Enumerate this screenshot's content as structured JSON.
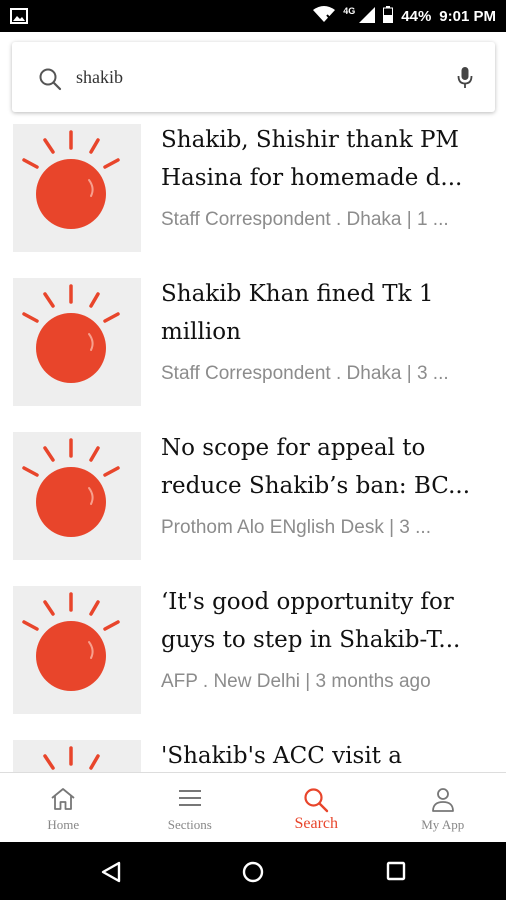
{
  "status_bar": {
    "network": "4G",
    "battery": "44%",
    "time": "9:01 PM"
  },
  "search": {
    "query": "shakib",
    "placeholder": ""
  },
  "colors": {
    "accent": "#e8452b",
    "thumb_bg": "#eeeeee",
    "meta_text": "#8c8c8c"
  },
  "articles": [
    {
      "line1": "Shakib, Shishir thank PM",
      "line2": "Hasina for homemade d...",
      "meta": "Staff Correspondent . Dhaka | 1 ..."
    },
    {
      "line1": "Shakib Khan fined Tk 1",
      "line2": "million",
      "meta": "Staff Correspondent . Dhaka | 3 ..."
    },
    {
      "line1": "No scope for appeal to",
      "line2": "reduce Shakib’s ban: BC...",
      "meta": "Prothom Alo ENglish Desk | 3  ..."
    },
    {
      "line1": "‘It's good opportunity for",
      "line2": "guys to step in Shakib-T...",
      "meta": "AFP . New Delhi | 3  months ago"
    },
    {
      "line1": "'Shakib's ACC visit a",
      "line2": "",
      "meta": ""
    }
  ],
  "nav": {
    "home": "Home",
    "sections": "Sections",
    "search": "Search",
    "my_app": "My App"
  },
  "icons": {
    "thumbnail": "sun-logo-icon",
    "search": "search-icon",
    "mic": "mic-icon",
    "home": "home-icon",
    "sections": "menu-icon",
    "profile": "person-icon"
  }
}
